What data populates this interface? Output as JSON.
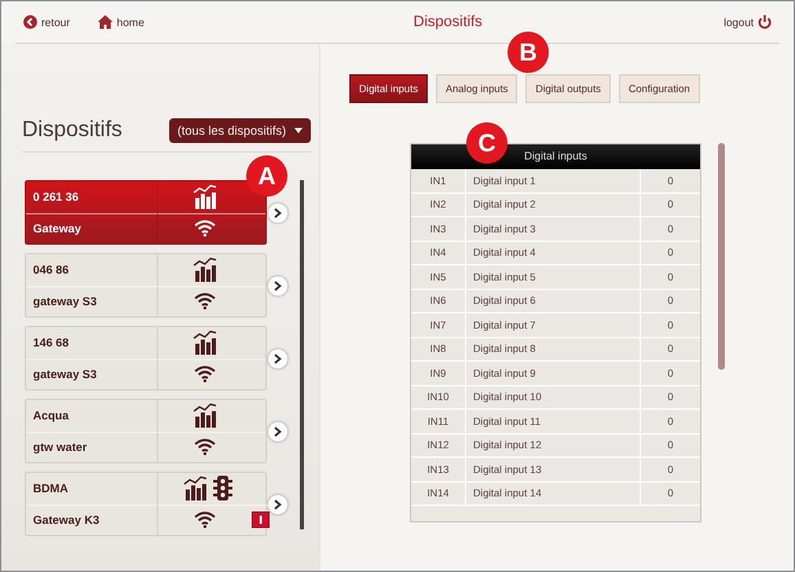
{
  "topbar": {
    "back": "retour",
    "home": "home",
    "title": "Dispositifs",
    "logout": "logout"
  },
  "sidebar": {
    "heading": "Dispositifs",
    "filter": "(tous les dispositifs)",
    "devices": [
      {
        "id": "0 261 36",
        "name": "Gateway",
        "selected": true,
        "traffic_light": false,
        "alert": false
      },
      {
        "id": "046 86",
        "name": "gateway S3",
        "selected": false,
        "traffic_light": false,
        "alert": false
      },
      {
        "id": "146 68",
        "name": "gateway S3",
        "selected": false,
        "traffic_light": false,
        "alert": false
      },
      {
        "id": "Acqua",
        "name": "gtw water",
        "selected": false,
        "traffic_light": false,
        "alert": false
      },
      {
        "id": "BDMA",
        "name": "Gateway K3",
        "selected": false,
        "traffic_light": true,
        "alert": true
      }
    ]
  },
  "tabs": [
    {
      "label": "Digital inputs",
      "selected": true
    },
    {
      "label": "Analog inputs",
      "selected": false
    },
    {
      "label": "Digital outputs",
      "selected": false
    },
    {
      "label": "Configuration",
      "selected": false
    }
  ],
  "table": {
    "title": "Digital inputs",
    "rows": [
      {
        "id": "IN1",
        "name": "Digital input 1",
        "value": "0"
      },
      {
        "id": "IN2",
        "name": "Digital input 2",
        "value": "0"
      },
      {
        "id": "IN3",
        "name": "Digital input 3",
        "value": "0"
      },
      {
        "id": "IN4",
        "name": "Digital input 4",
        "value": "0"
      },
      {
        "id": "IN5",
        "name": "Digital input 5",
        "value": "0"
      },
      {
        "id": "IN6",
        "name": "Digital input 6",
        "value": "0"
      },
      {
        "id": "IN7",
        "name": "Digital input 7",
        "value": "0"
      },
      {
        "id": "IN8",
        "name": "Digital input 8",
        "value": "0"
      },
      {
        "id": "IN9",
        "name": "Digital input 9",
        "value": "0"
      },
      {
        "id": "IN10",
        "name": "Digital input 10",
        "value": "0"
      },
      {
        "id": "IN11",
        "name": "Digital input 11",
        "value": "0"
      },
      {
        "id": "IN12",
        "name": "Digital input 12",
        "value": "0"
      },
      {
        "id": "IN13",
        "name": "Digital input 13",
        "value": "0"
      },
      {
        "id": "IN14",
        "name": "Digital input 14",
        "value": "0"
      }
    ]
  },
  "callouts": [
    "A",
    "B",
    "C"
  ]
}
